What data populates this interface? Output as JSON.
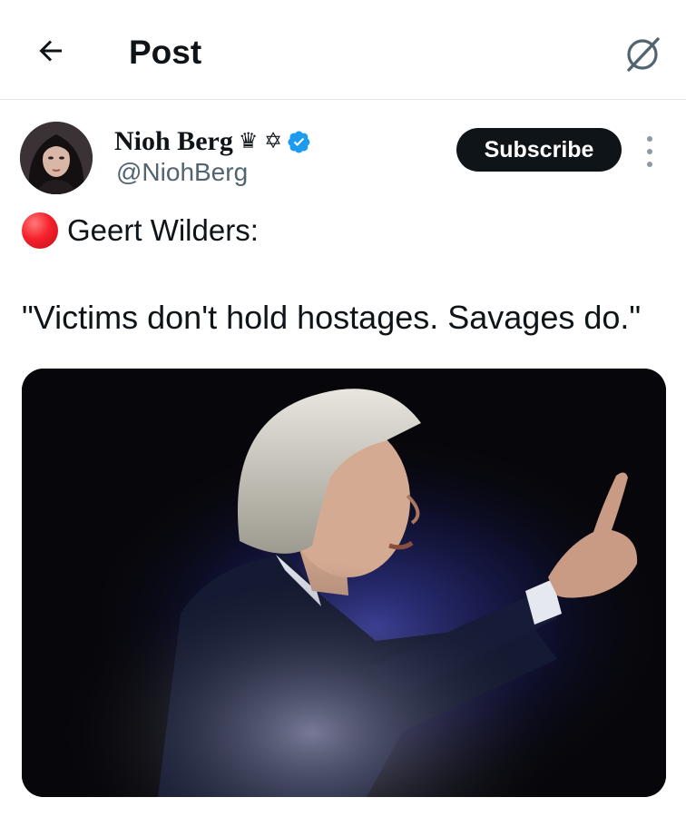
{
  "header": {
    "title": "Post",
    "back_icon": "arrow-left-icon",
    "grok_icon": "grok-icon"
  },
  "author": {
    "name": "Nioh Berg",
    "emoji": "♛ ✡",
    "handle": "@NiohBerg",
    "verified": true,
    "verified_color": "#1d9bf0"
  },
  "actions": {
    "subscribe_label": "Subscribe",
    "more_icon": "more-vertical-icon"
  },
  "tweet": {
    "line1_emoji": "red-circle",
    "line1_text": "Geert Wilders:",
    "quote": "\"Victims don't hold hostages. Savages do.\""
  },
  "media": {
    "type": "photo"
  }
}
